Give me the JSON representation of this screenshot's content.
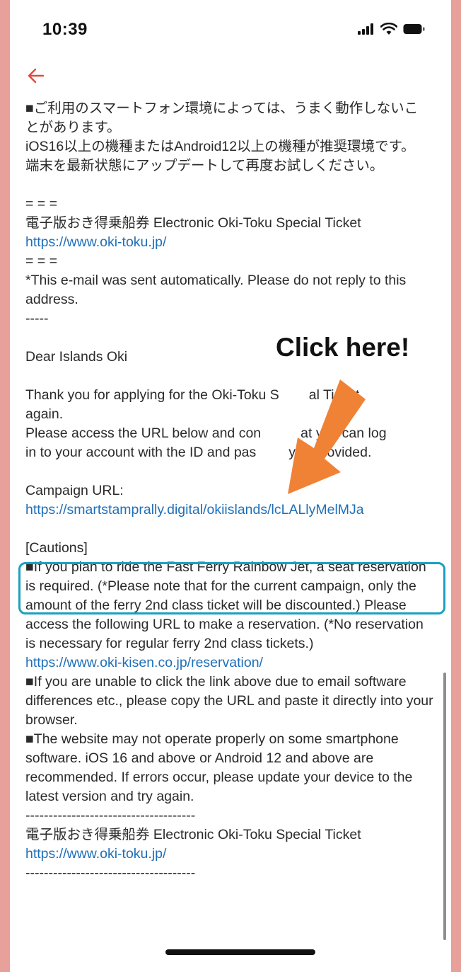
{
  "status": {
    "time": "10:39"
  },
  "colors": {
    "link": "#1f6fb8",
    "box": "#1aa0c0",
    "arrow": "#f08236",
    "back": "#e04a3f"
  },
  "email": {
    "lines_top": [
      "■ご利用のスマートフォン環境によっては、うまく動作しないこ",
      "とがあります。",
      "iOS16以上の機種またはAndroid12以上の機種が推奨環境です。",
      "端末を最新状態にアップデートして再度お試しください。"
    ],
    "sep1": "= = =",
    "product_name": "電子版おき得乗船券 Electronic Oki-Toku Special Ticket",
    "product_url": "https://www.oki-toku.jp/",
    "sep2": "= = =",
    "auto_notice": "*This e-mail was sent automatically. Please do not reply to this address.",
    "dashes": "-----",
    "greeting": "Dear Islands Oki",
    "thanks_1": "Thank you for applying for the Oki-Toku S",
    "thanks_2": "al Ticket",
    "thanks_3": "again.",
    "access_1": "Please access the URL below and con",
    "access_2": "at you can log",
    "access_3": "in to your account with the ID and pas",
    "access_4": "you provided.",
    "campaign_label": "Campaign URL:",
    "campaign_url": "https://smartstamprally.digital/okiislands/lcLALlyMelMJa",
    "cautions_title": "[Cautions]",
    "caution_1": "■If you plan to ride the Fast Ferry Rainbow Jet, a seat reservation is required. (*Please note that for the current campaign, only the amount of the ferry 2nd class ticket will be discounted.) Please access the following URL to make a reservation. (*No reservation is necessary for regular ferry 2nd class tickets.)",
    "reservation_url": "https://www.oki-kisen.co.jp/reservation/",
    "caution_2": "■If you are unable to click the link above due to email software differences etc., please copy the URL and paste it directly into your browser.",
    "caution_3": "■The website may not operate properly on some smartphone software. iOS 16 and above or Android 12 and above are recommended. If errors occur, please update your device to the latest version and try again.",
    "footer_sep": "-------------------------------------",
    "footer_name": "電子版おき得乗船券 Electronic Oki-Toku Special Ticket",
    "footer_url": "https://www.oki-toku.jp/",
    "footer_sep2": "-------------------------------------"
  },
  "annotation": {
    "callout": "Click here!"
  }
}
